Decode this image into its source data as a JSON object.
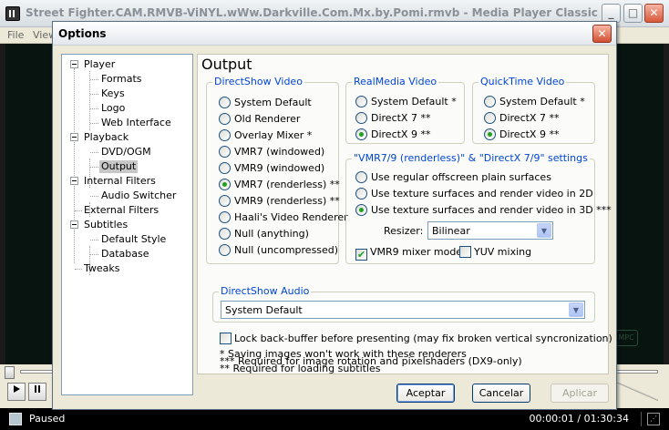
{
  "mpc": {
    "title": "Street Fighter.CAM.RMVB-ViNYL.wWw.Darkville.Com.Mx.by.Pomi.rmvb - Media Player Classic",
    "menu": [
      "File",
      "View"
    ],
    "controls": {
      "minimize": "_",
      "maximize": "□",
      "close": "✕"
    },
    "watermark": "MPC",
    "status": "Paused",
    "time": "00:00:01 / 01:30:34",
    "play_icon": "play-icon",
    "pause_icon": "pause-icon"
  },
  "dialog": {
    "title": "Options",
    "close_glyph": "✕",
    "tree": {
      "player": "Player",
      "formats": "Formats",
      "keys": "Keys",
      "logo": "Logo",
      "web_interface": "Web Interface",
      "playback": "Playback",
      "dvd_ogm": "DVD/OGM",
      "output": "Output",
      "internal_filters": "Internal Filters",
      "audio_switcher": "Audio Switcher",
      "external_filters": "External Filters",
      "subtitles": "Subtitles",
      "default_style": "Default Style",
      "database": "Database",
      "tweaks": "Tweaks"
    },
    "page": {
      "title": "Output",
      "directshow_video": {
        "legend": "DirectShow Video",
        "options": [
          "System Default",
          "Old Renderer",
          "Overlay Mixer *",
          "VMR7 (windowed)",
          "VMR9 (windowed)",
          "VMR7 (renderless) **",
          "VMR9 (renderless) **",
          "Haali's Video Renderer",
          "Null (anything)",
          "Null (uncompressed)"
        ],
        "selected": 5
      },
      "realmedia_video": {
        "legend": "RealMedia Video",
        "options": [
          "System Default *",
          "DirectX 7 **",
          "DirectX 9 **"
        ],
        "selected": 2
      },
      "quicktime_video": {
        "legend": "QuickTime Video",
        "options": [
          "System Default *",
          "DirectX 7 **",
          "DirectX 9 **"
        ],
        "selected": 2
      },
      "vmr_settings": {
        "legend": "\"VMR7/9 (renderless)\" & \"DirectX 7/9\" settings",
        "options": [
          "Use regular offscreen plain surfaces",
          "Use texture surfaces and render video in 2D",
          "Use texture surfaces and render video in 3D ***"
        ],
        "selected": 2,
        "resizer_label": "Resizer:",
        "resizer_value": "Bilinear",
        "vmr9_mixer_label": "VMR9 mixer mode",
        "vmr9_mixer_checked": true,
        "yuv_mixing_label": "YUV mixing",
        "yuv_mixing_checked": false
      },
      "directshow_audio": {
        "legend": "DirectShow Audio",
        "value": "System Default"
      },
      "lock_backbuffer_label": "Lock back-buffer before presenting (may fix broken vertical syncronization)",
      "lock_backbuffer_checked": false,
      "notes": [
        "* Saving images won't work with these renderers",
        "** Required for loading subtitles",
        "*** Required for image rotation and pixelshaders (DX9-only)"
      ]
    },
    "buttons": {
      "ok": "Aceptar",
      "cancel": "Cancelar",
      "apply": "Aplicar"
    }
  }
}
